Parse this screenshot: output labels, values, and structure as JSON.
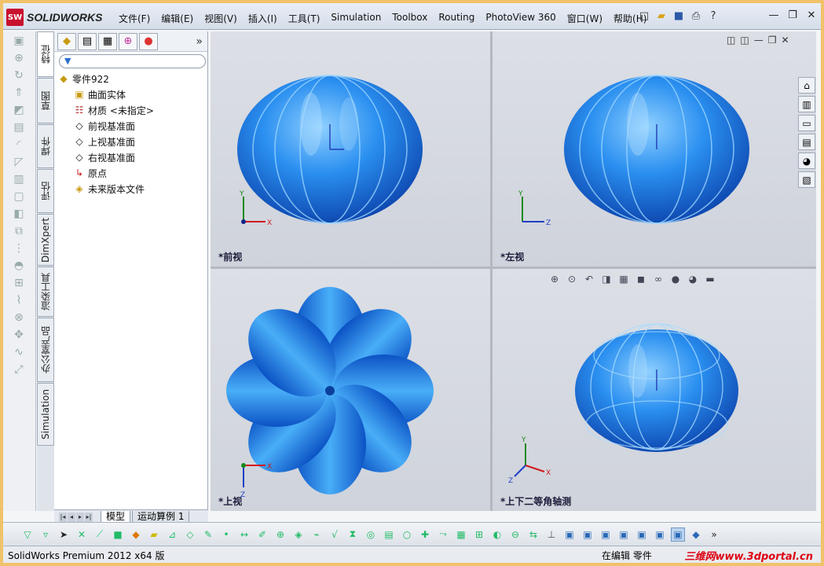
{
  "app": {
    "brand": "SOLIDWORKS",
    "logo_text": "SW"
  },
  "menu": [
    "文件(F)",
    "编辑(E)",
    "视图(V)",
    "插入(I)",
    "工具(T)",
    "Simulation",
    "Toolbox",
    "Routing",
    "PhotoView 360",
    "窗口(W)",
    "帮助(H)"
  ],
  "quick_access": [
    "new-icon",
    "open-icon",
    "save-icon",
    "print-icon",
    "help-icon"
  ],
  "window_controls": [
    "minimize",
    "restore",
    "close"
  ],
  "vtabs": [
    "特征",
    "草图",
    "焊件",
    "评估",
    "DimXpert",
    "渲染工具",
    "办公室产品",
    "Simulation"
  ],
  "feature_manager": {
    "filter_placeholder": "",
    "root": "零件922",
    "items": [
      {
        "label": "曲面实体",
        "icon": "surface-bodies-icon"
      },
      {
        "label": "材质 <未指定>",
        "icon": "material-icon"
      },
      {
        "label": "前视基准面",
        "icon": "plane-icon"
      },
      {
        "label": "上视基准面",
        "icon": "plane-icon"
      },
      {
        "label": "右视基准面",
        "icon": "plane-icon"
      },
      {
        "label": "原点",
        "icon": "origin-icon"
      },
      {
        "label": "未来版本文件",
        "icon": "future-version-icon"
      }
    ]
  },
  "bottom_tabs": {
    "model": "模型",
    "motion": "运动算例 1"
  },
  "viewports": {
    "front": {
      "label": "*前视",
      "axis_labels": [
        "Y",
        "X"
      ]
    },
    "left": {
      "label": "*左视",
      "axis_labels": [
        "Y",
        "Z"
      ]
    },
    "top": {
      "label": "*上视",
      "axis_labels": [
        "X",
        "Z"
      ]
    },
    "iso": {
      "label": "*上下二等角轴测",
      "axis_labels": [
        "Y",
        "X",
        "Z"
      ]
    }
  },
  "status": {
    "left": "SolidWorks Premium 2012 x64 版",
    "right": "在编辑 零件"
  },
  "watermark": "三维网www.3dportal.cn",
  "colors": {
    "part": "#1f7fe0",
    "part_dark": "#0b4fb8",
    "accent": "#c8102e"
  }
}
